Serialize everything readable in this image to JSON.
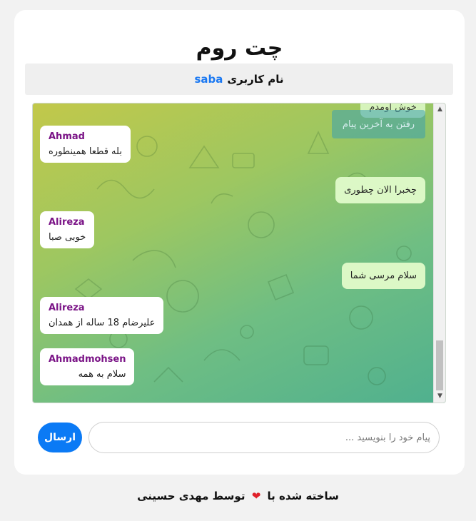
{
  "header": {
    "title": "چت روم"
  },
  "user": {
    "label": "نام کاربری",
    "name": "saba"
  },
  "chat": {
    "partial_top_text": "خوش اومدم",
    "jump_button_label": "رفتن به آخرین پیام",
    "messages": [
      {
        "direction": "in",
        "sender": "Ahmad",
        "text": "بله قطعا همینطوره"
      },
      {
        "direction": "out",
        "text": "چخبرا الان چطوری"
      },
      {
        "direction": "in",
        "sender": "Alireza",
        "text": "خوبی صبا"
      },
      {
        "direction": "out",
        "text": "سلام مرسی شما"
      },
      {
        "direction": "in",
        "sender": "Alireza",
        "text": "علیرضام 18 ساله از همدان"
      },
      {
        "direction": "in",
        "sender": "Ahmadmohsen",
        "text": "سلام به همه"
      }
    ]
  },
  "composer": {
    "placeholder": "پیام خود را بنویسید ...",
    "value": "",
    "send_label": "ارسال"
  },
  "footer": {
    "prefix": "ساخته شده با",
    "suffix": "توسط مهدی حسینی",
    "heart_icon": "heart-icon"
  },
  "colors": {
    "accent": "#0b7af5",
    "sender": "#7a1386",
    "outgoing_bubble": "#dcf8c6",
    "username": "#1a78f2"
  }
}
